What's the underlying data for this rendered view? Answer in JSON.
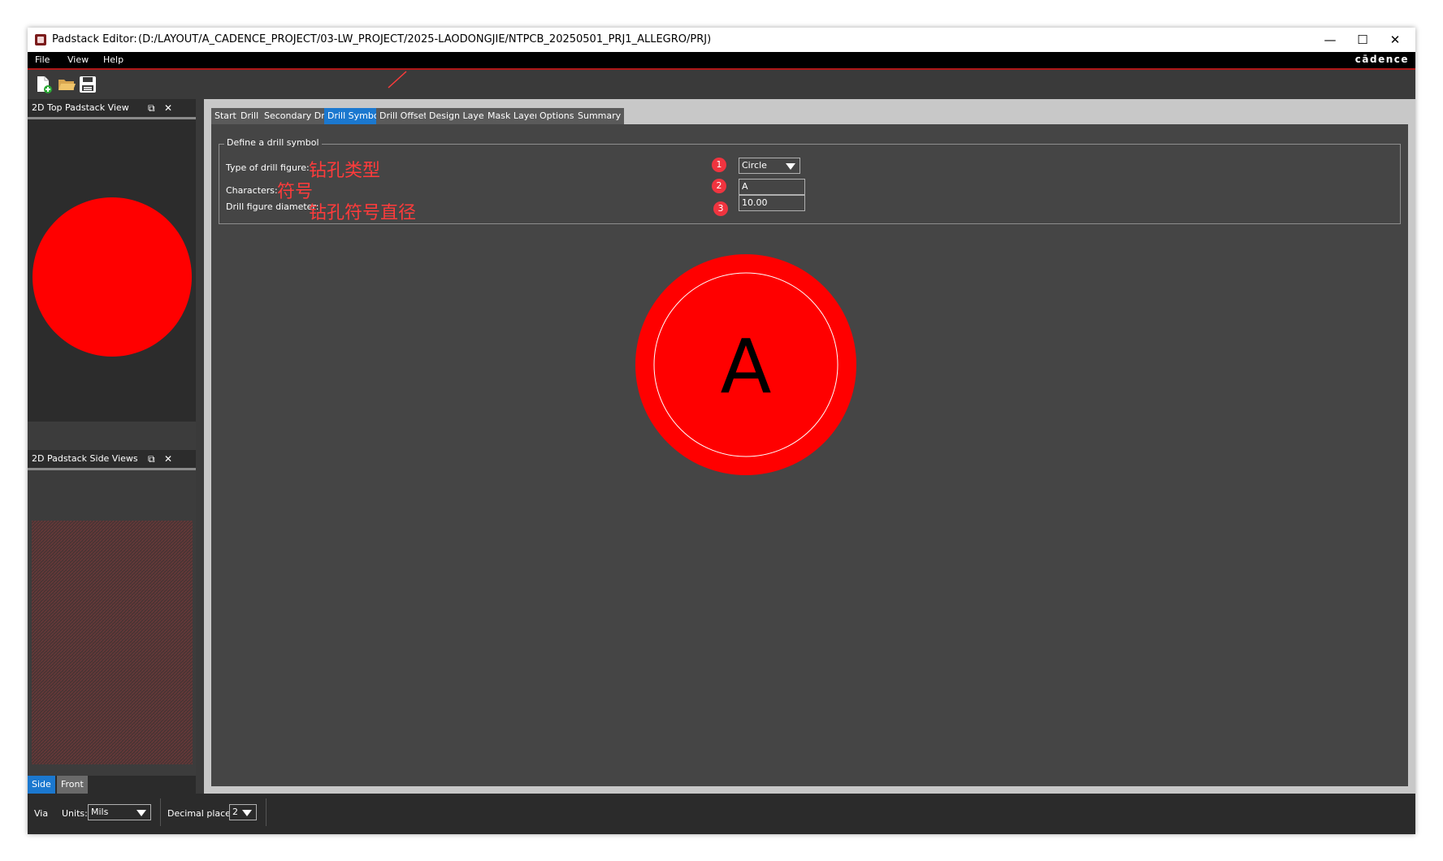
{
  "window": {
    "app_title": "Padstack Editor:",
    "path": "(D:/LAYOUT/A_CADENCE_PROJECT/03-LW_PROJECT/2025-LAODONGJIE/NTPCB_20250501_PRJ1_ALLEGRO/PRJ)",
    "minimize_icon": "minimize-icon",
    "maximize_icon": "maximize-icon",
    "close_icon": "close-icon"
  },
  "menu": {
    "items": [
      "File",
      "View",
      "Help"
    ],
    "brand": "cādence"
  },
  "toolbar": {
    "icons": [
      "new-file-icon",
      "open-folder-icon",
      "save-icon"
    ]
  },
  "left_panels": {
    "top_view": {
      "title": "2D Top Padstack View"
    },
    "side_view": {
      "title": "2D Padstack Side Views"
    },
    "view_tabs": [
      "Side",
      "Front"
    ]
  },
  "tabs": [
    {
      "label": "Start",
      "active": false
    },
    {
      "label": "Drill",
      "active": false
    },
    {
      "label": "Secondary Drill",
      "active": false
    },
    {
      "label": "Drill Symbol",
      "active": true
    },
    {
      "label": "Drill Offset",
      "active": false
    },
    {
      "label": "Design Layers",
      "active": false
    },
    {
      "label": "Mask Layers",
      "active": false
    },
    {
      "label": "Options",
      "active": false
    },
    {
      "label": "Summary",
      "active": false
    }
  ],
  "drill_symbol": {
    "group_title": "Define a drill symbol",
    "fields": [
      {
        "label": "Type of drill figure:",
        "annotation": "钻孔类型",
        "badge": "1",
        "value": "Circle"
      },
      {
        "label": "Characters:",
        "annotation": "符号",
        "badge": "2",
        "value": "A"
      },
      {
        "label": "Drill figure diameter:",
        "annotation": "钻孔符号直径",
        "badge": "3",
        "value": "10.00"
      }
    ],
    "preview_character": "A"
  },
  "status": {
    "mode": "Via",
    "units_label": "Units:",
    "units_value": "Mils",
    "decimal_label": "Decimal places:",
    "decimal_value": "2"
  },
  "colors": {
    "drill_fill": "#ff0000",
    "active_tab": "#1b78cf",
    "annotation": "#ff3b3b",
    "badge": "#f0343f"
  }
}
